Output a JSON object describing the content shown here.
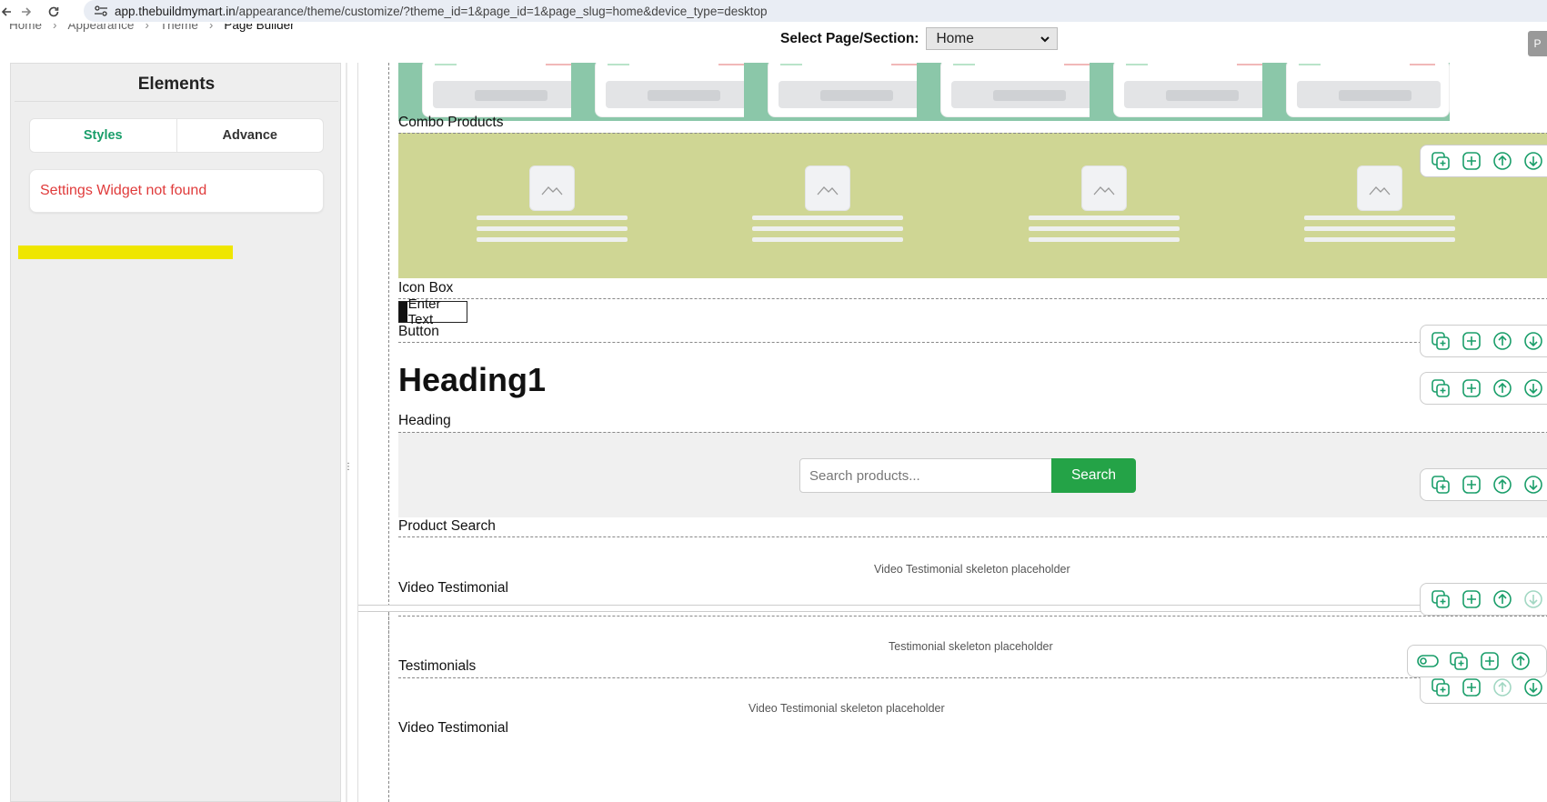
{
  "browser": {
    "url_domain": "app.thebuildmymart.in",
    "url_path": "/appearance/theme/customize/?theme_id=1&page_id=1&page_slug=home&device_type=desktop"
  },
  "breadcrumb": [
    "Home",
    "Appearance",
    "Theme",
    "Page Builder"
  ],
  "page_select": {
    "label": "Select Page/Section:",
    "value": "Home"
  },
  "sidebar": {
    "title": "Elements",
    "tabs": [
      {
        "label": "Styles"
      },
      {
        "label": "Advance"
      }
    ],
    "message": "Settings Widget not found"
  },
  "canvas": {
    "blocks": {
      "combo_products": "Combo Products",
      "icon_box": "Icon Box",
      "button": "Button",
      "heading": "Heading",
      "product_search": "Product Search",
      "video_testimonial_1": "Video Testimonial",
      "testimonials": "Testimonials",
      "video_testimonial_2": "Video Testimonial"
    },
    "enter_text": "Enter Text",
    "heading_text": "Heading1",
    "search_placeholder": "Search products...",
    "search_button": "Search",
    "video_placeholder_1": "Video Testimonial skeleton placeholder",
    "testimonial_placeholder": "Testimonial skeleton placeholder",
    "video_placeholder_2": "Video Testimonial skeleton placeholder"
  },
  "colors": {
    "accent_green": "#1a9e6a",
    "search_green": "#24a347",
    "error_red": "#e03b3b",
    "combo_bg": "#cfd694",
    "highlight_yellow": "#efe600"
  }
}
